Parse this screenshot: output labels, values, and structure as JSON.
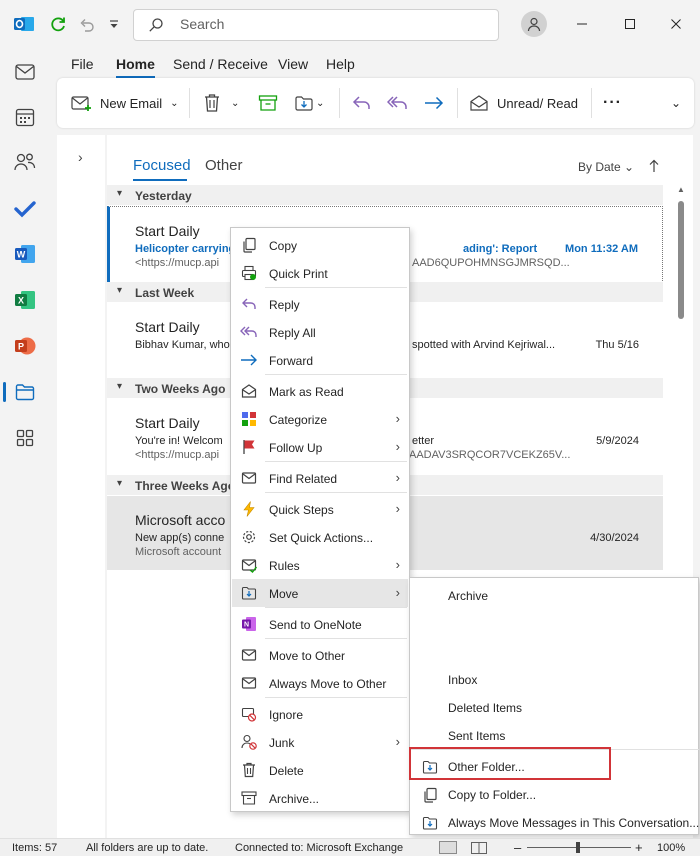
{
  "search": {
    "placeholder": "Search"
  },
  "menu_tabs": [
    "File",
    "Home",
    "Send / Receive",
    "View",
    "Help"
  ],
  "ribbon": {
    "new_email": "New Email",
    "unread_read": "Unread/ Read",
    "more": "···"
  },
  "list": {
    "tabs": [
      "Focused",
      "Other"
    ],
    "sort": "By Date",
    "groups": [
      "Yesterday",
      "Last Week",
      "Two Weeks Ago",
      "Three Weeks Ago"
    ],
    "items": [
      {
        "sender": "Start Daily",
        "subject": "Helicopter carrying",
        "subject_tail": "ading': Report",
        "preview": "<https://mucp.api",
        "preview_tail": "AAD6QUPOHMNSGJMRSQD...",
        "date": "Mon 11:32 AM"
      },
      {
        "sender": "Start Daily",
        "subject": "Bibhav Kumar, who",
        "subject_tail": "spotted with Arvind Kejriwal...",
        "date": "Thu 5/16"
      },
      {
        "sender": "Start Daily",
        "subject": "You're in! Welcom",
        "subject_tail": "etter",
        "preview": "<https://mucp.api",
        "preview_tail": "AADAV3SRQCOR7VCEKZ65V...",
        "date": "5/9/2024"
      },
      {
        "sender": "Microsoft acco",
        "subject": "New app(s) conne",
        "preview": "Microsoft account",
        "date": "4/30/2024"
      }
    ]
  },
  "context_menu": {
    "items": [
      {
        "label": "Copy",
        "icon": "copy-icon"
      },
      {
        "label": "Quick Print",
        "icon": "print-icon"
      },
      {
        "label": "Reply",
        "icon": "reply-icon"
      },
      {
        "label": "Reply All",
        "icon": "reply-all-icon"
      },
      {
        "label": "Forward",
        "icon": "forward-icon"
      },
      {
        "label": "Mark as Read",
        "icon": "envelope-open-icon"
      },
      {
        "label": "Categorize",
        "icon": "categorize-icon"
      },
      {
        "label": "Follow Up",
        "icon": "flag-icon"
      },
      {
        "label": "Find Related",
        "icon": "find-icon"
      },
      {
        "label": "Quick Steps",
        "icon": "lightning-icon"
      },
      {
        "label": "Set Quick Actions...",
        "icon": "gear-icon"
      },
      {
        "label": "Rules",
        "icon": "rules-icon"
      },
      {
        "label": "Move",
        "icon": "move-icon"
      },
      {
        "label": "Send to OneNote",
        "icon": "onenote-icon"
      },
      {
        "label": "Move to Other",
        "icon": "envelope-icon"
      },
      {
        "label": "Always Move to Other",
        "icon": "envelope-icon"
      },
      {
        "label": "Ignore",
        "icon": "ignore-icon"
      },
      {
        "label": "Junk",
        "icon": "junk-icon"
      },
      {
        "label": "Delete",
        "icon": "trash-icon"
      },
      {
        "label": "Archive...",
        "icon": "archive-icon"
      }
    ]
  },
  "move_submenu": {
    "items": [
      "Archive",
      "Inbox",
      "Deleted Items",
      "Sent Items",
      "Other Folder...",
      "Copy to Folder...",
      "Always Move Messages in This Conversation..."
    ]
  },
  "status": {
    "items": "Items: 57",
    "sync": "All folders are up to date.",
    "connection": "Connected to: Microsoft Exchange",
    "zoom": "100%"
  },
  "colors": {
    "accent": "#0f6cbd",
    "highlight_box": "#d13438",
    "selected_row": "#e6e6e6"
  }
}
